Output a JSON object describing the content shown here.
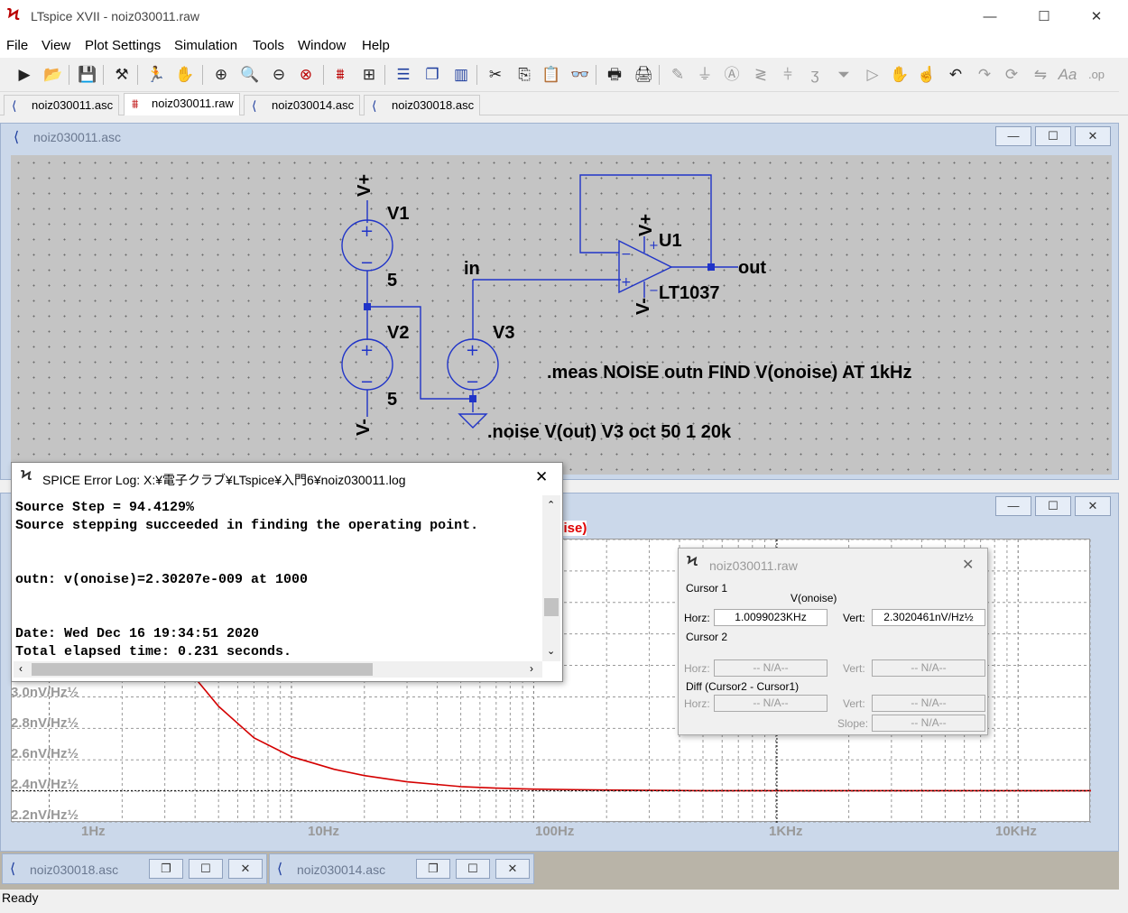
{
  "app": {
    "title": "LTspice XVII - noiz030011.raw"
  },
  "menu": [
    "File",
    "View",
    "Plot Settings",
    "Simulation",
    "Tools",
    "Window",
    "Help"
  ],
  "toolbar_icons": [
    "run-icon",
    "open-icon",
    "save-icon",
    "control-panel-icon",
    "halt-icon",
    "pan-icon",
    "zoom-in-icon",
    "zoom-area-icon",
    "zoom-out-icon",
    "zoom-cancel-icon",
    "autorange-icon",
    "grid-icon",
    "tile-horizontal-icon",
    "cascade-icon",
    "tile-vertical-icon",
    "cut-icon",
    "copy-icon",
    "paste-icon",
    "find-icon",
    "print-icon",
    "print-preview-icon",
    "wire-icon",
    "ground-icon",
    "label-icon",
    "resistor-icon",
    "capacitor-icon",
    "inductor-icon",
    "diode-icon",
    "component-icon",
    "move-icon",
    "drag-icon",
    "undo-icon",
    "redo-icon",
    "rotate-icon",
    "mirror-icon",
    "text-icon",
    "spice-directive-icon"
  ],
  "tabs": [
    {
      "label": "noiz030011.asc",
      "icon": "schematic-icon"
    },
    {
      "label": "noiz030011.raw",
      "icon": "waveform-icon"
    },
    {
      "label": "noiz030014.asc",
      "icon": "schematic-icon"
    },
    {
      "label": "noiz030018.asc",
      "icon": "schematic-icon"
    }
  ],
  "schematic": {
    "title": "noiz030011.asc",
    "labels": {
      "vplus1": "V+",
      "v1": "V1",
      "v1val": "5",
      "v2": "V2",
      "v2val": "5",
      "vminus1": "V-",
      "v3": "V3",
      "in": "in",
      "u1": "U1",
      "lt": "LT1037",
      "out": "out",
      "oa_vplus": "V+",
      "oa_vminus": "V-"
    },
    "meas": ".meas NOISE outn FIND V(onoise) AT 1kHz",
    "noise": ".noise V(out) V3 oct 50 1 20k"
  },
  "errlog": {
    "title": "SPICE Error Log: X:¥電子クラブ¥LTspice¥入門6¥noiz030011.log",
    "text": "Source Step = 94.4129%\nSource stepping succeeded in finding the operating point.\n\n\noutn: v(onoise)=2.30207e-009 at 1000\n\n\nDate: Wed Dec 16 19:34:51 2020\nTotal elapsed time: 0.231 seconds."
  },
  "plot": {
    "trace_label": "V(onoise)",
    "trace_color": "#ff0000"
  },
  "chart_data": {
    "type": "line",
    "xscale": "log",
    "x_ticks": [
      "1Hz",
      "10Hz",
      "100Hz",
      "1KHz",
      "10KHz"
    ],
    "y_ticks": [
      "3.0nV/Hz½",
      "2.8nV/Hz½",
      "2.6nV/Hz½",
      "2.4nV/Hz½",
      "2.2nV/Hz½"
    ],
    "xlim": [
      0.7,
      20000
    ],
    "ylim": [
      2.2,
      3.1
    ],
    "series": [
      {
        "name": "V(onoise)",
        "color": "#d40000",
        "x": [
          1.8,
          2,
          3,
          4,
          5,
          7,
          10,
          15,
          20,
          30,
          50,
          70,
          100,
          200,
          500,
          1000,
          2000,
          5000,
          10000,
          20000
        ],
        "y": [
          3.1,
          3.02,
          2.8,
          2.66,
          2.57,
          2.47,
          2.41,
          2.37,
          2.35,
          2.33,
          2.315,
          2.31,
          2.307,
          2.304,
          2.302,
          2.302,
          2.302,
          2.302,
          2.302,
          2.302
        ]
      }
    ]
  },
  "cursor": {
    "title": "noiz030011.raw",
    "cursor1": "Cursor 1",
    "trace": "V(onoise)",
    "horz_label": "Horz:",
    "vert_label": "Vert:",
    "horz1": "1.0099023KHz",
    "vert1": "2.3020461nV/Hz½",
    "cursor2": "Cursor 2",
    "na": "-- N/A--",
    "diff": "Diff (Cursor2 - Cursor1)",
    "slope_label": "Slope:"
  },
  "minimized": [
    {
      "title": "noiz030018.asc"
    },
    {
      "title": "noiz030014.asc"
    }
  ],
  "status": "Ready"
}
